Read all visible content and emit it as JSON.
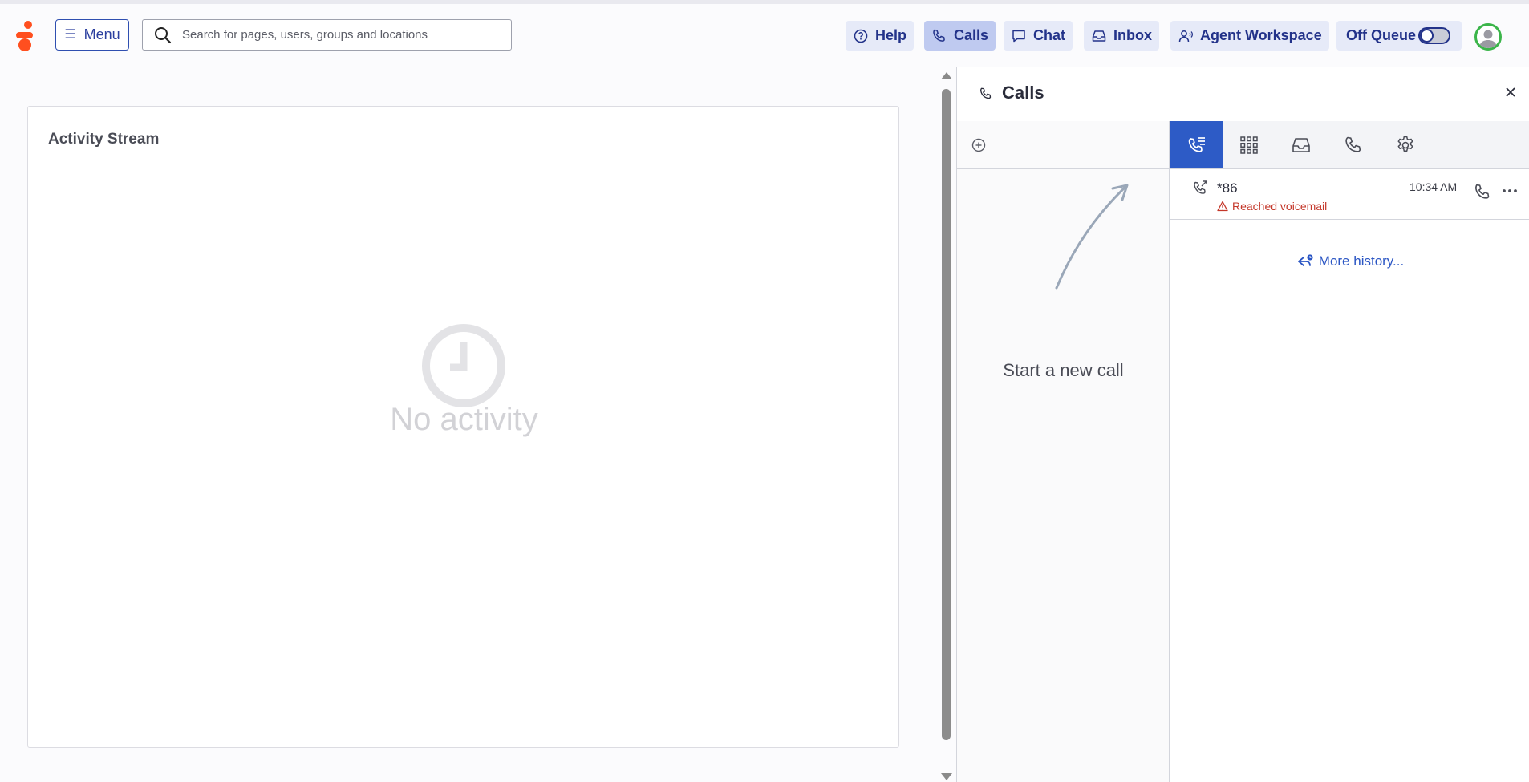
{
  "header": {
    "menu_label": "Menu",
    "search_placeholder": "Search for pages, users, groups and locations",
    "buttons": {
      "help": "Help",
      "calls": "Calls",
      "chat": "Chat",
      "inbox": "Inbox",
      "agent_workspace": "Agent Workspace"
    },
    "queue_label": "Off Queue",
    "queue_on": false
  },
  "activity": {
    "title": "Activity Stream",
    "empty_text": "No activity"
  },
  "calls_panel": {
    "title": "Calls",
    "new_call_hint": "Start a new call",
    "tabs": [
      "call-history",
      "dialpad",
      "voicemail",
      "phone",
      "settings"
    ],
    "active_tab": "call-history",
    "history": [
      {
        "number": "*86",
        "status": "Reached voicemail",
        "time": "10:34 AM"
      }
    ],
    "more_history": "More history..."
  },
  "colors": {
    "brand": "#ff4f1f",
    "accent": "#2d5bc6",
    "header_button_bg": "#e6eaf8",
    "active_button_bg": "#bfcaf0",
    "error": "#c4372a"
  }
}
